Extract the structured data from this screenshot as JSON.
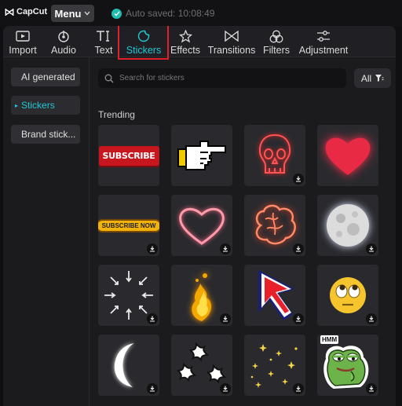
{
  "app": {
    "brand": "CapCut",
    "menu_label": "Menu",
    "autosave_text": "Auto saved: 10:08:49"
  },
  "tabs": [
    {
      "label": "Import",
      "icon": "import-icon"
    },
    {
      "label": "Audio",
      "icon": "audio-icon"
    },
    {
      "label": "Text",
      "icon": "text-icon"
    },
    {
      "label": "Stickers",
      "icon": "stickers-icon",
      "active": true
    },
    {
      "label": "Effects",
      "icon": "effects-icon"
    },
    {
      "label": "Transitions",
      "icon": "transitions-icon"
    },
    {
      "label": "Filters",
      "icon": "filters-icon"
    },
    {
      "label": "Adjustment",
      "icon": "adjustment-icon"
    }
  ],
  "sidebar": {
    "items": [
      {
        "label": "AI generated"
      },
      {
        "label": "Stickers",
        "active": true
      },
      {
        "label": "Brand stick..."
      }
    ]
  },
  "search": {
    "placeholder": "Search for stickers"
  },
  "filter": {
    "label": "All"
  },
  "section": {
    "title": "Trending"
  },
  "stickers": [
    {
      "name": "subscribe-red-sticker",
      "text": "SUBSCRIBE",
      "download": false
    },
    {
      "name": "pixel-hand-sticker",
      "download": false
    },
    {
      "name": "neon-skull-sticker",
      "download": true
    },
    {
      "name": "glowing-heart-sticker",
      "download": false
    },
    {
      "name": "subscribe-now-sticker",
      "text": "SUBSCRIBE NOW",
      "download": true
    },
    {
      "name": "neon-heart-outline-sticker",
      "download": true
    },
    {
      "name": "neon-brain-sticker",
      "download": true
    },
    {
      "name": "full-moon-sticker",
      "download": true
    },
    {
      "name": "radial-arrows-sticker",
      "download": true
    },
    {
      "name": "fire-explosion-sticker",
      "download": true
    },
    {
      "name": "red-arrow-cursor-sticker",
      "download": true
    },
    {
      "name": "rolling-eyes-emoji-sticker",
      "download": true
    },
    {
      "name": "crescent-moon-sticker",
      "download": true
    },
    {
      "name": "anger-symbols-sticker",
      "download": true
    },
    {
      "name": "sparkle-stars-sticker",
      "download": true
    },
    {
      "name": "frog-meme-sticker",
      "text": "HMM",
      "download": true
    }
  ]
}
